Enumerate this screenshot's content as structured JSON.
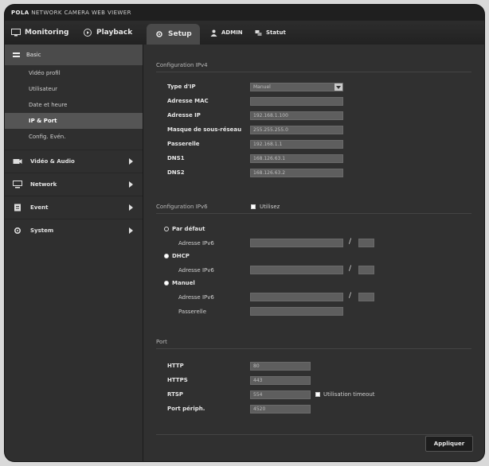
{
  "app": {
    "title_brand": "POLA",
    "title_rest": "NETWORK CAMERA WEB VIEWER"
  },
  "topnav": {
    "monitoring": "Monitoring",
    "playback": "Playback",
    "setup": "Setup",
    "user": "ADMIN",
    "status": "Statut"
  },
  "sidebar": {
    "header": "Basic",
    "subitems": [
      "Vidéo profil",
      "Utilisateur",
      "Date et heure",
      "IP & Port",
      "Config. Evén."
    ],
    "active_index": 3,
    "categories": [
      "Vidéo & Audio",
      "Network",
      "Event",
      "System"
    ]
  },
  "ipv4": {
    "section": "Configuration IPv4",
    "rows": [
      {
        "label": "Type d'IP",
        "value": "Manuel"
      },
      {
        "label": "Adresse MAC",
        "value": ""
      },
      {
        "label": "Adresse IP",
        "value": "192.168.1.100"
      },
      {
        "label": "Masque de sous-réseau",
        "value": "255.255.255.0"
      },
      {
        "label": "Passerelle",
        "value": "192.168.1.1"
      },
      {
        "label": "DNS1",
        "value": "168.126.63.1"
      },
      {
        "label": "DNS2",
        "value": "168.126.63.2"
      }
    ]
  },
  "ipv6": {
    "section": "Configuration IPv6",
    "checkbox": "Utilisez",
    "default_label": "Par défaut",
    "dhcp_label": "DHCP",
    "manual_label": "Manuel",
    "ipv6_addr_label": "Adresse IPv6",
    "gateway_label": "Passerelle",
    "slash": "/"
  },
  "port": {
    "section": "Port",
    "rows": [
      {
        "label": "HTTP",
        "value": "80"
      },
      {
        "label": "HTTPS",
        "value": "443"
      },
      {
        "label": "RTSP",
        "value": "554"
      },
      {
        "label": "Port périph.",
        "value": "4520"
      }
    ],
    "timeout_label": "Utilisation timeout"
  },
  "buttons": {
    "apply": "Appliquer"
  }
}
